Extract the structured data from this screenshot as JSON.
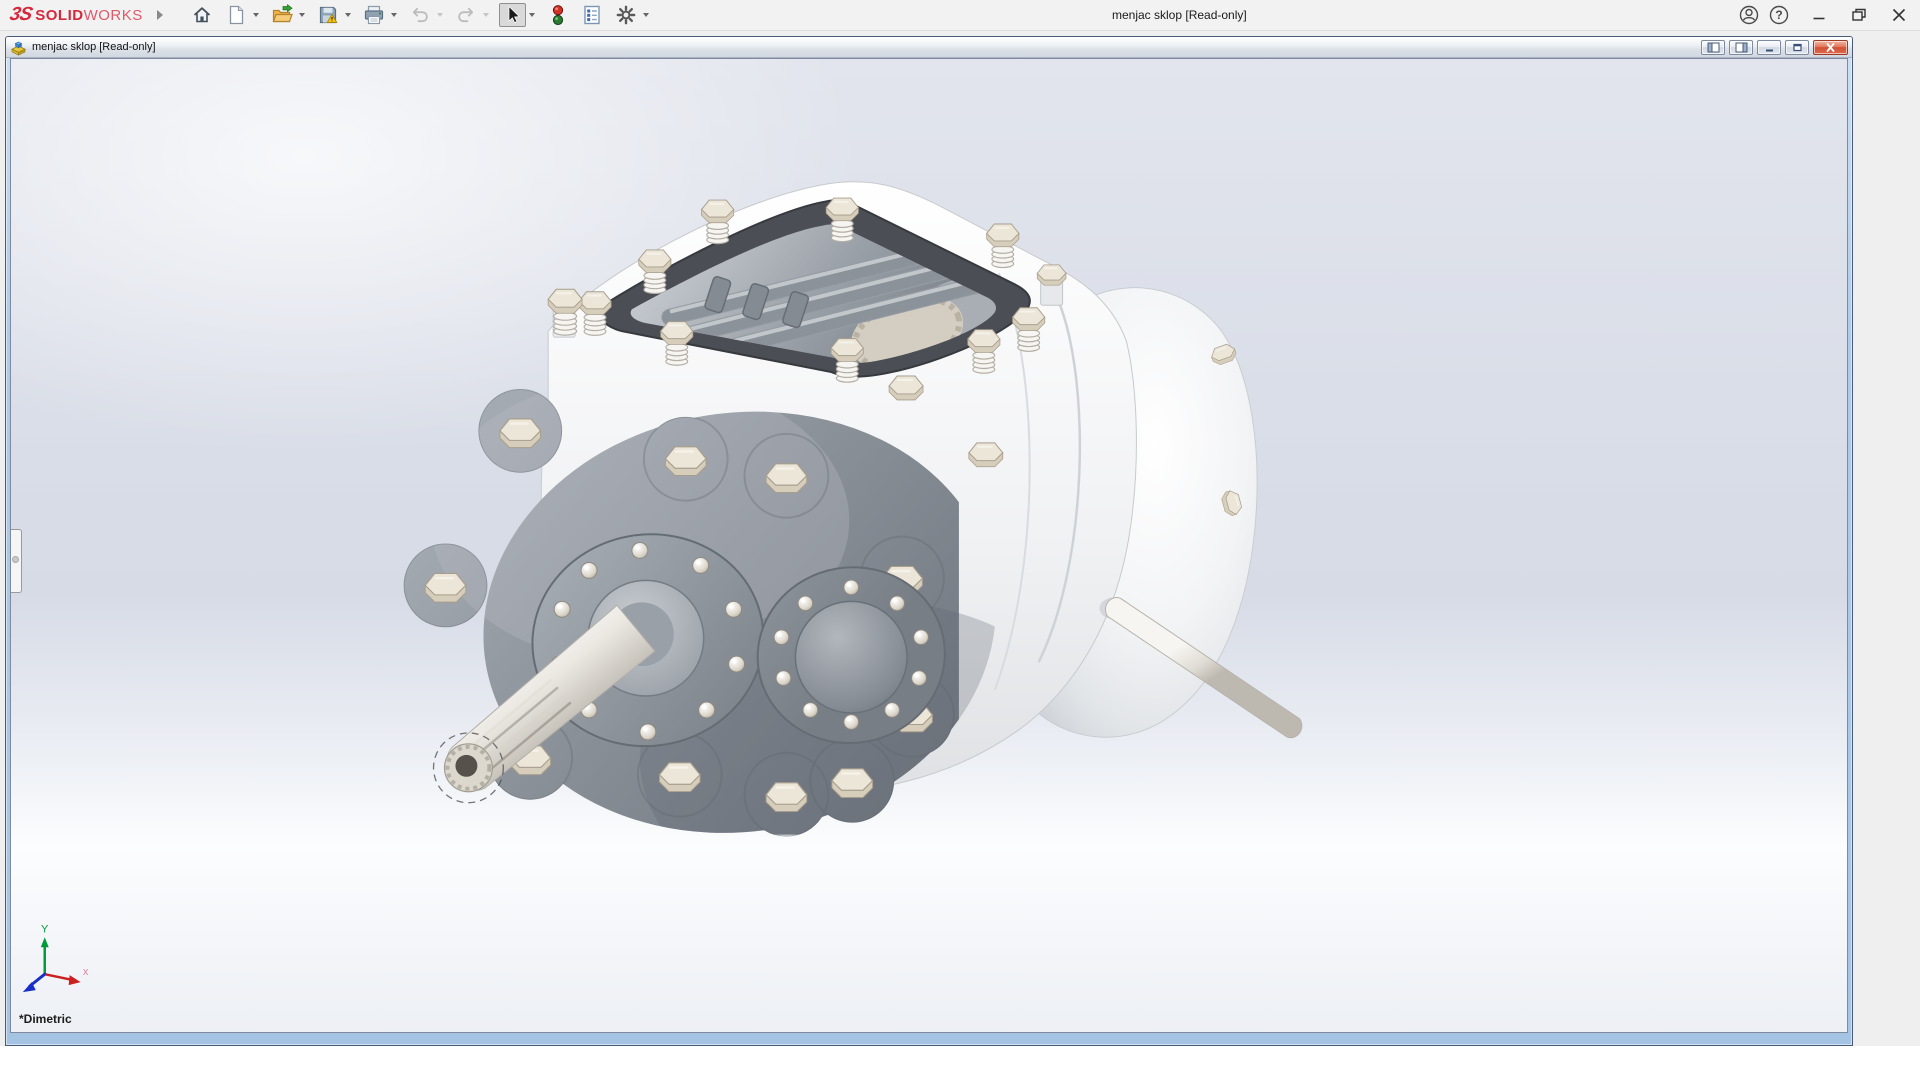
{
  "app": {
    "logo_mark": "3S",
    "logo_solid": "SOLID",
    "logo_works": "WORKS",
    "title": "menjac sklop [Read-only]"
  },
  "document": {
    "title": "menjac sklop [Read-only]"
  },
  "toolbar": {
    "items": [
      "home",
      "new-document",
      "open",
      "save",
      "print",
      "undo",
      "redo",
      "select",
      "rebuild",
      "file-properties",
      "options"
    ],
    "disabled_items": [
      "undo",
      "redo"
    ],
    "active_item": "select"
  },
  "window_controls": {
    "app": [
      "account",
      "help",
      "minimize",
      "restore",
      "close"
    ],
    "document": [
      "pane-left",
      "pane-right",
      "minimize",
      "restore",
      "close"
    ]
  },
  "viewport": {
    "orientation_label": "*Dimetric",
    "model": "menjac sklop",
    "triad": {
      "y": "Y",
      "x": "x"
    }
  },
  "icons": {
    "help_glyph": "?"
  },
  "colors": {
    "brand_red": "#d5283c",
    "titlebar_bg": "#f2f2f2",
    "doc_frame_blue": "#aecbe8",
    "doc_close_red": "#d9553d",
    "viewport_top": "#dde1ea",
    "viewport_bottom": "#eef1f6",
    "housing_gray": "#e8eaec",
    "plate_gray": "#858b93",
    "gasket_dark": "#4b4e54",
    "bolt_cream": "#e3dccd",
    "triad_y_green": "#009a3c",
    "triad_x_red": "#cc2020",
    "triad_z_blue": "#1830c8"
  }
}
